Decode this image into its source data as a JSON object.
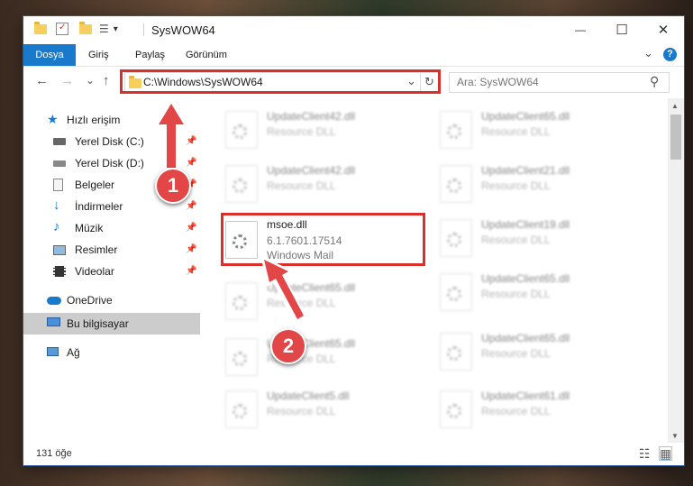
{
  "window": {
    "title": "SysWOW64"
  },
  "titlebar": {
    "dropdown_glyph": "▾",
    "minimize_glyph": "—",
    "maximize_glyph": "☐",
    "close_glyph": "✕"
  },
  "ribbon": {
    "tabs": [
      {
        "label": "Dosya",
        "active": true
      },
      {
        "label": "Giriş"
      },
      {
        "label": "Paylaş"
      },
      {
        "label": "Görünüm"
      }
    ],
    "collapse_glyph": "⌄",
    "help_glyph": "?"
  },
  "navigation": {
    "back_glyph": "←",
    "forward_glyph": "→",
    "recent_glyph": "⌄",
    "up_glyph": "↑",
    "address_path": "C:\\Windows\\SysWOW64",
    "address_dropdown_glyph": "⌄",
    "refresh_glyph": "↻",
    "search_placeholder": "Ara: SysWOW64",
    "search_glyph": "⚲"
  },
  "sidebar": {
    "pin_glyph": "📌",
    "items": [
      {
        "label": "Hızlı erişim"
      },
      {
        "label": "Yerel Disk (C:)"
      },
      {
        "label": "Yerel Disk (D:)"
      },
      {
        "label": "Belgeler"
      },
      {
        "label": "İndirmeler"
      },
      {
        "label": "Müzik"
      },
      {
        "label": "Resimler"
      },
      {
        "label": "Videolar"
      },
      {
        "label": "OneDrive"
      },
      {
        "label": "Bu bilgisayar"
      },
      {
        "label": "Ağ"
      }
    ]
  },
  "files": {
    "left": [
      {
        "name": "UpdateClient42.dll",
        "type": "Resource DLL"
      },
      {
        "name": "UpdateClient42.dll",
        "type": "Resource DLL"
      },
      {
        "name": "msoe.dll",
        "type": "6.1.7601.17514",
        "desc": "Windows Mail"
      },
      {
        "name": "UpdateClient65.dll",
        "type": "Resource DLL"
      },
      {
        "name": "UpdateClient65.dll",
        "type": "Resource DLL"
      },
      {
        "name": "UpdateClient5.dll",
        "type": "Resource DLL"
      }
    ],
    "right": [
      {
        "name": "UpdateClient65.dll",
        "type": "Resource DLL"
      },
      {
        "name": "UpdateClient21.dll",
        "type": "Resource DLL"
      },
      {
        "name": "UpdateClient19.dll",
        "type": "Resource DLL"
      },
      {
        "name": "UpdateClient65.dll",
        "type": "Resource DLL"
      },
      {
        "name": "UpdateClient65.dll",
        "type": "Resource DLL"
      },
      {
        "name": "UpdateClient61.dll",
        "type": "Resource DLL"
      }
    ]
  },
  "scrollbar": {
    "up_glyph": "▲",
    "down_glyph": "▼"
  },
  "status": {
    "item_count": "131 öğe",
    "details_view_glyph": "☷",
    "tiles_view_glyph": "▦"
  },
  "annotations": {
    "marker1": "1",
    "marker2": "2"
  },
  "colors": {
    "accent": "#1979ca",
    "highlight": "#d9302b",
    "marker": "#e24646"
  }
}
